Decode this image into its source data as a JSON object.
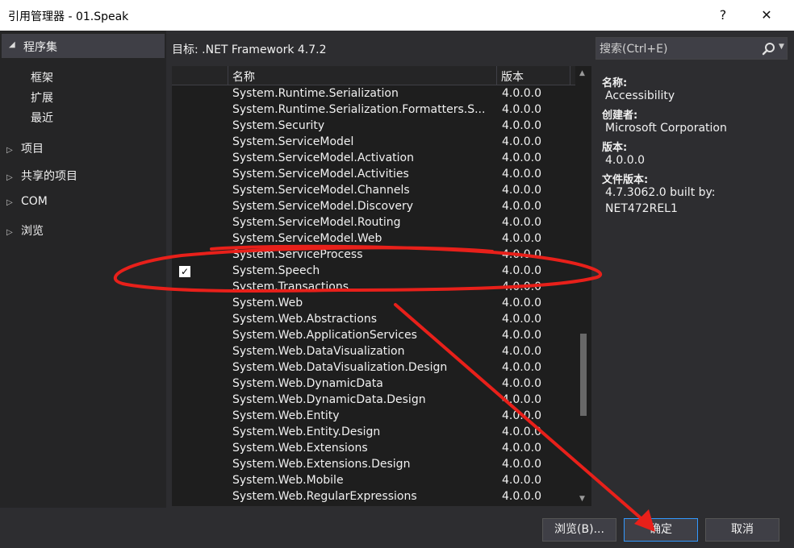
{
  "window": {
    "title": "引用管理器 - 01.Speak",
    "help_glyph": "?",
    "close_glyph": "✕"
  },
  "sidebar": {
    "section_header": "程序集",
    "sub_items": [
      "框架",
      "扩展",
      "最近"
    ],
    "categories": [
      "项目",
      "共享的项目",
      "COM",
      "浏览"
    ]
  },
  "target": "目标: .NET Framework 4.7.2",
  "search": {
    "placeholder": "搜索(Ctrl+E)"
  },
  "list": {
    "columns": [
      "名称",
      "版本"
    ],
    "rows": [
      {
        "name": "System.Runtime.Serialization",
        "version": "4.0.0.0",
        "checked": false
      },
      {
        "name": "System.Runtime.Serialization.Formatters.S...",
        "version": "4.0.0.0",
        "checked": false
      },
      {
        "name": "System.Security",
        "version": "4.0.0.0",
        "checked": false
      },
      {
        "name": "System.ServiceModel",
        "version": "4.0.0.0",
        "checked": false
      },
      {
        "name": "System.ServiceModel.Activation",
        "version": "4.0.0.0",
        "checked": false
      },
      {
        "name": "System.ServiceModel.Activities",
        "version": "4.0.0.0",
        "checked": false
      },
      {
        "name": "System.ServiceModel.Channels",
        "version": "4.0.0.0",
        "checked": false
      },
      {
        "name": "System.ServiceModel.Discovery",
        "version": "4.0.0.0",
        "checked": false
      },
      {
        "name": "System.ServiceModel.Routing",
        "version": "4.0.0.0",
        "checked": false
      },
      {
        "name": "System.ServiceModel.Web",
        "version": "4.0.0.0",
        "checked": false
      },
      {
        "name": "System.ServiceProcess",
        "version": "4.0.0.0",
        "checked": false
      },
      {
        "name": "System.Speech",
        "version": "4.0.0.0",
        "checked": true
      },
      {
        "name": "System.Transactions",
        "version": "4.0.0.0",
        "checked": false
      },
      {
        "name": "System.Web",
        "version": "4.0.0.0",
        "checked": false
      },
      {
        "name": "System.Web.Abstractions",
        "version": "4.0.0.0",
        "checked": false
      },
      {
        "name": "System.Web.ApplicationServices",
        "version": "4.0.0.0",
        "checked": false
      },
      {
        "name": "System.Web.DataVisualization",
        "version": "4.0.0.0",
        "checked": false
      },
      {
        "name": "System.Web.DataVisualization.Design",
        "version": "4.0.0.0",
        "checked": false
      },
      {
        "name": "System.Web.DynamicData",
        "version": "4.0.0.0",
        "checked": false
      },
      {
        "name": "System.Web.DynamicData.Design",
        "version": "4.0.0.0",
        "checked": false
      },
      {
        "name": "System.Web.Entity",
        "version": "4.0.0.0",
        "checked": false
      },
      {
        "name": "System.Web.Entity.Design",
        "version": "4.0.0.0",
        "checked": false
      },
      {
        "name": "System.Web.Extensions",
        "version": "4.0.0.0",
        "checked": false
      },
      {
        "name": "System.Web.Extensions.Design",
        "version": "4.0.0.0",
        "checked": false
      },
      {
        "name": "System.Web.Mobile",
        "version": "4.0.0.0",
        "checked": false
      },
      {
        "name": "System.Web.RegularExpressions",
        "version": "4.0.0.0",
        "checked": false
      }
    ]
  },
  "details": {
    "name_label": "名称:",
    "name_value": "Accessibility",
    "creator_label": "创建者:",
    "creator_value": "Microsoft Corporation",
    "version_label": "版本:",
    "version_value": "4.0.0.0",
    "file_version_label": "文件版本:",
    "file_version_value_line1": "4.7.3062.0 built by:",
    "file_version_value_line2": "NET472REL1"
  },
  "buttons": {
    "browse": "浏览(B)...",
    "ok": "确定",
    "cancel": "取消"
  },
  "colors": {
    "background": "#2d2d30",
    "list_background": "#1e1e1e",
    "annotation_red": "#e8201a"
  }
}
